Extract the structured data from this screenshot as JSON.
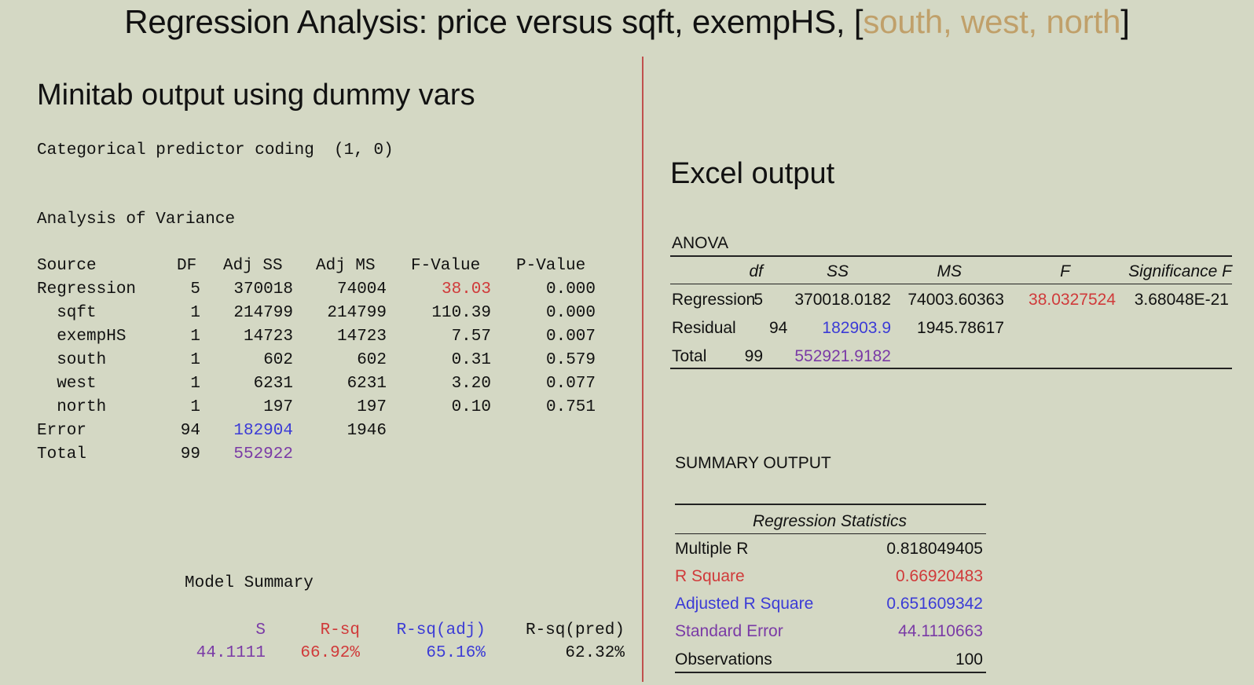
{
  "title": {
    "prefix": "Regression Analysis: price versus sqft, exempHS, [",
    "highlight": "south, west, north",
    "suffix": "]"
  },
  "minitab": {
    "heading": "Minitab output using dummy vars",
    "coding_line": "Categorical predictor coding  (1, 0)",
    "anova_label": "Analysis of Variance",
    "headers": [
      "Source",
      "DF",
      "Adj SS",
      "Adj MS",
      "F-Value",
      "P-Value"
    ],
    "rows": [
      [
        "Regression",
        "5",
        "370018",
        "74004",
        "38.03",
        "0.000"
      ],
      [
        "  sqft",
        "1",
        "214799",
        "214799",
        "110.39",
        "0.000"
      ],
      [
        "  exempHS",
        "1",
        "14723",
        "14723",
        "7.57",
        "0.007"
      ],
      [
        "  south",
        "1",
        "602",
        "602",
        "0.31",
        "0.579"
      ],
      [
        "  west",
        "1",
        "6231",
        "6231",
        "3.20",
        "0.077"
      ],
      [
        "  north",
        "1",
        "197",
        "197",
        "0.10",
        "0.751"
      ],
      [
        "Error",
        "94",
        "182904",
        "1946",
        "",
        ""
      ],
      [
        "Total",
        "99",
        "552922",
        "",
        "",
        ""
      ]
    ],
    "model_summary_label": "Model Summary",
    "summary_headers": [
      "S",
      "R-sq",
      "R-sq(adj)",
      "R-sq(pred)"
    ],
    "summary_values": [
      "44.1111",
      "66.92%",
      "65.16%",
      "62.32%"
    ]
  },
  "excel": {
    "heading": "Excel output",
    "anova_label": "ANOVA",
    "headers": [
      "df",
      "SS",
      "MS",
      "F",
      "Significance F"
    ],
    "rows": [
      [
        "Regression",
        "5",
        "370018.0182",
        "74003.60363",
        "38.0327524",
        "3.68048E-21"
      ],
      [
        "Residual",
        "94",
        "182903.9",
        "1945.78617",
        "",
        ""
      ],
      [
        "Total",
        "99",
        "552921.9182",
        "",
        "",
        ""
      ]
    ],
    "summary_label": "SUMMARY OUTPUT",
    "stats_heading": "Regression Statistics",
    "stats": [
      [
        "Multiple R",
        "0.818049405"
      ],
      [
        "R Square",
        "0.66920483"
      ],
      [
        "Adjusted R Square",
        "0.651609342"
      ],
      [
        "Standard Error",
        "44.1110663"
      ],
      [
        "Observations",
        "100"
      ]
    ]
  },
  "colors": {
    "background": "#d4d8c4",
    "highlight": "#c0a06a",
    "red": "#d03a3a",
    "blue": "#3b3bd6",
    "purple": "#7a3aa6",
    "divider": "#c0504d"
  }
}
